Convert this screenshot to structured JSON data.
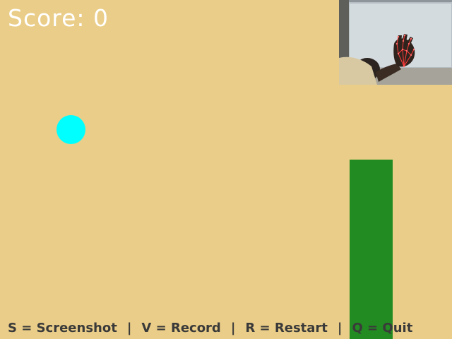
{
  "hud": {
    "score_text": "Score: 0"
  },
  "controls": {
    "screenshot": "S = Screenshot",
    "record": "V = Record",
    "restart": "R = Restart",
    "quit": "Q = Quit",
    "separator": "|"
  },
  "colors": {
    "background": "#EACD88",
    "ball": "#00FFFF",
    "pipe": "#228B22",
    "score_text": "#FFFFFF",
    "controls_text": "#3A3A3A",
    "hand_landmarks": "#FF3B3B"
  },
  "webcam": {
    "content": "hand-tracking-preview"
  }
}
